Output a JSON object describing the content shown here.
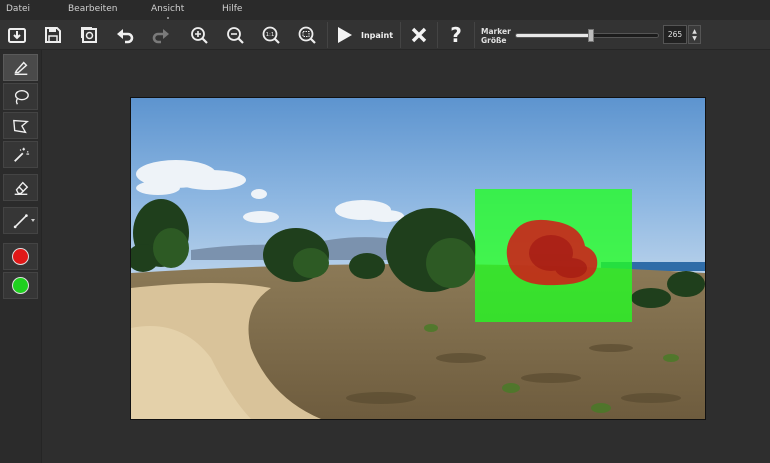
{
  "menu": {
    "items": [
      {
        "label": "Datei"
      },
      {
        "label": "Bearbeiten"
      },
      {
        "label": "Ansicht"
      },
      {
        "label": "Hilfe"
      }
    ]
  },
  "toolbar": {
    "icons": [
      "open-icon",
      "save-icon",
      "save-as-icon",
      "undo-icon",
      "redo-icon",
      "zoom-in-icon",
      "zoom-out-icon",
      "zoom-actual-icon",
      "zoom-fit-icon",
      "play-icon",
      "close-icon",
      "help-icon"
    ],
    "inpaint_label": "Inpaint",
    "help_label": "?",
    "marker_label_line1": "Marker",
    "marker_label_line2": "Größe",
    "marker_size": "265",
    "marker_slider_fraction": 0.53
  },
  "tools": {
    "items": [
      "marker-icon",
      "lasso-icon",
      "polygon-lasso-icon",
      "magic-wand-icon",
      "eraser-icon",
      "line-icon"
    ],
    "colors": {
      "red": "#e01818",
      "green": "#1fd11f"
    }
  },
  "colors": {
    "accent": "#e0e0e0",
    "mask_red": "#d41818",
    "mask_green": "#22ff22"
  }
}
